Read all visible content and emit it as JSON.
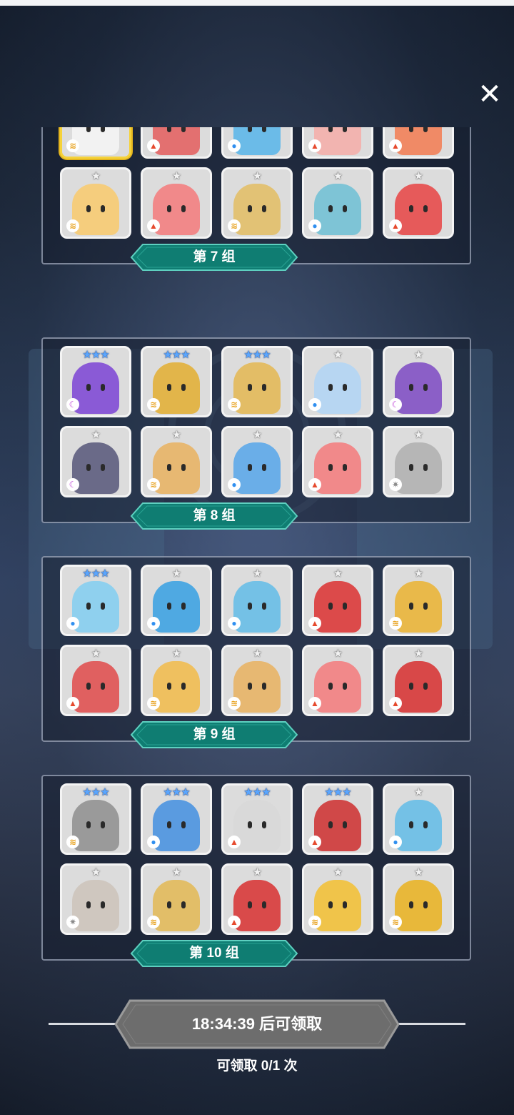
{
  "close_label": "✕",
  "groups": [
    {
      "label": "第 7 组",
      "heroes": [
        {
          "stars": "★★★★★",
          "tier": "g",
          "el": "wind",
          "color": "#f2f2f2",
          "gold": true
        },
        {
          "stars": "★★★",
          "tier": "s",
          "el": "fire",
          "color": "#e37070"
        },
        {
          "stars": "★",
          "tier": "w",
          "el": "water",
          "color": "#6bbbe8"
        },
        {
          "stars": "★",
          "tier": "w",
          "el": "fire",
          "color": "#f2b4b0"
        },
        {
          "stars": "★",
          "tier": "w",
          "el": "fire",
          "color": "#f08a66"
        },
        {
          "stars": "★",
          "tier": "w",
          "el": "wind",
          "color": "#f5cd7d"
        },
        {
          "stars": "★",
          "tier": "w",
          "el": "fire",
          "color": "#f1898a"
        },
        {
          "stars": "★",
          "tier": "w",
          "el": "wind",
          "color": "#e2c275"
        },
        {
          "stars": "★",
          "tier": "w",
          "el": "water",
          "color": "#7ec4d6"
        },
        {
          "stars": "★",
          "tier": "w",
          "el": "fire",
          "color": "#e65a5a"
        }
      ]
    },
    {
      "label": "第 8 组",
      "heroes": [
        {
          "stars": "★★★",
          "tier": "s",
          "el": "dark",
          "color": "#8a5ad6"
        },
        {
          "stars": "★★★",
          "tier": "s",
          "el": "wind",
          "color": "#e2b54a"
        },
        {
          "stars": "★★★",
          "tier": "s",
          "el": "wind",
          "color": "#e3bd66"
        },
        {
          "stars": "★",
          "tier": "w",
          "el": "water",
          "color": "#b7d6f2"
        },
        {
          "stars": "★",
          "tier": "w",
          "el": "dark",
          "color": "#8b5fc7"
        },
        {
          "stars": "★",
          "tier": "w",
          "el": "dark",
          "color": "#6a6a88"
        },
        {
          "stars": "★",
          "tier": "w",
          "el": "wind",
          "color": "#e7b872"
        },
        {
          "stars": "★",
          "tier": "w",
          "el": "water",
          "color": "#6aaee8"
        },
        {
          "stars": "★",
          "tier": "w",
          "el": "fire",
          "color": "#f1898a"
        },
        {
          "stars": "★",
          "tier": "w",
          "el": "light",
          "color": "#b6b6b6"
        }
      ]
    },
    {
      "label": "第 9 组",
      "heroes": [
        {
          "stars": "★★★",
          "tier": "s",
          "el": "water",
          "color": "#8fd0ee"
        },
        {
          "stars": "★",
          "tier": "w",
          "el": "water",
          "color": "#4fa9e2"
        },
        {
          "stars": "★",
          "tier": "w",
          "el": "water",
          "color": "#74c1e6"
        },
        {
          "stars": "★",
          "tier": "w",
          "el": "fire",
          "color": "#dc4a4a"
        },
        {
          "stars": "★",
          "tier": "w",
          "el": "wind",
          "color": "#e9b94a"
        },
        {
          "stars": "★",
          "tier": "w",
          "el": "fire",
          "color": "#e06060"
        },
        {
          "stars": "★",
          "tier": "w",
          "el": "wind",
          "color": "#efc05f"
        },
        {
          "stars": "★",
          "tier": "w",
          "el": "wind",
          "color": "#e7b872"
        },
        {
          "stars": "★",
          "tier": "w",
          "el": "fire",
          "color": "#f1898a"
        },
        {
          "stars": "★",
          "tier": "w",
          "el": "fire",
          "color": "#d84848"
        }
      ]
    },
    {
      "label": "第 10 组",
      "heroes": [
        {
          "stars": "★★★",
          "tier": "s",
          "el": "wind",
          "color": "#9a9a9a"
        },
        {
          "stars": "★★★",
          "tier": "s",
          "el": "water",
          "color": "#5a9be0"
        },
        {
          "stars": "★★★",
          "tier": "s",
          "el": "fire",
          "color": "#d9d9d9"
        },
        {
          "stars": "★★★",
          "tier": "s",
          "el": "fire",
          "color": "#d04848"
        },
        {
          "stars": "★",
          "tier": "w",
          "el": "water",
          "color": "#74c1e6"
        },
        {
          "stars": "★",
          "tier": "w",
          "el": "light",
          "color": "#cfc7bf"
        },
        {
          "stars": "★",
          "tier": "w",
          "el": "wind",
          "color": "#e2be68"
        },
        {
          "stars": "★",
          "tier": "w",
          "el": "fire",
          "color": "#d94a4a"
        },
        {
          "stars": "★",
          "tier": "w",
          "el": "wind",
          "color": "#f0c44a"
        },
        {
          "stars": "★",
          "tier": "w",
          "el": "wind",
          "color": "#e8b83a"
        }
      ]
    }
  ],
  "claim_button": "18:34:39 后可领取",
  "claim_count": "可领取 0/1 次",
  "element_icons": {
    "fire": "▲",
    "water": "●",
    "wind": "≋",
    "dark": "☾",
    "light": "✷"
  }
}
